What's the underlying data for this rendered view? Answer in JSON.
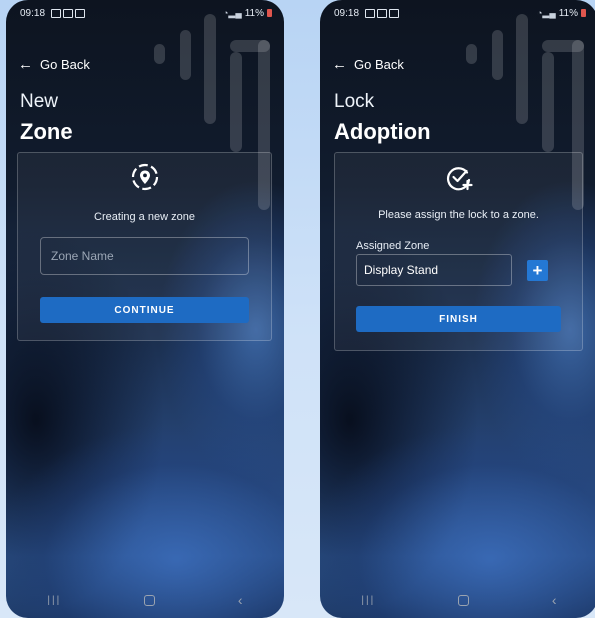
{
  "status_bar": {
    "time": "09:18",
    "battery": "11%"
  },
  "nav": {
    "back_label": "Go Back",
    "back_glyph": "←"
  },
  "zone_screen": {
    "title_line1": "New",
    "title_line2": "Zone",
    "icon": "location-pin-dashed-circle-icon",
    "message": "Creating a new zone",
    "input_placeholder": "Zone Name",
    "input_value": "",
    "button_label": "CONTINUE"
  },
  "lock_screen": {
    "title_line1": "Lock",
    "title_line2": "Adoption",
    "icon": "check-circle-plus-icon",
    "message": "Please assign the lock to a zone.",
    "field_label": "Assigned Zone",
    "field_value": "Display Stand",
    "add_glyph": "+",
    "button_label": "FINISH"
  },
  "system_nav": {
    "recent_glyph": "|||",
    "back_glyph": "‹"
  },
  "colors": {
    "accent": "#1e6bc3",
    "add_button": "#2478d4",
    "battery": "#e0564e"
  }
}
